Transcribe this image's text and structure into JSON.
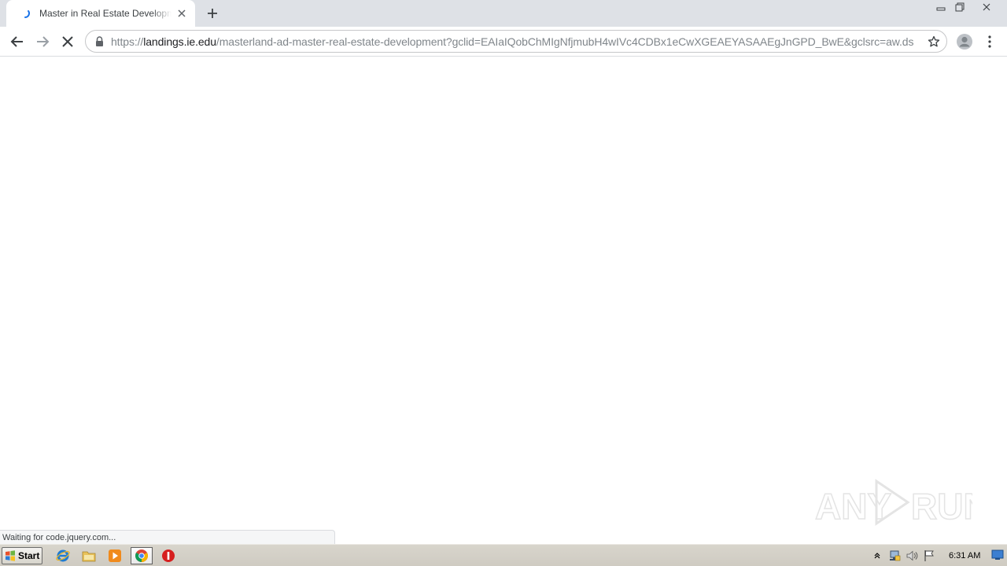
{
  "browser": {
    "tab": {
      "title": "Master in Real Estate Development - IE"
    },
    "address": {
      "scheme": "https://",
      "host": "landings.ie.edu",
      "path": "/masterland-ad-master-real-estate-development?gclid=EAIaIQobChMIgNfjmubH4wIVc4CDBx1eCwXGEAEYASAAEgJnGPD_BwE&gclsrc=aw.ds"
    },
    "status_text": "Waiting for code.jquery.com...",
    "watermark": "ANY RUN"
  },
  "taskbar": {
    "start_label": "Start",
    "clock": "6:31 AM"
  },
  "colors": {
    "spinner": "#1a73e8",
    "chrome_frame": "#dee1e6",
    "taskbar": "#d4d0c8"
  }
}
